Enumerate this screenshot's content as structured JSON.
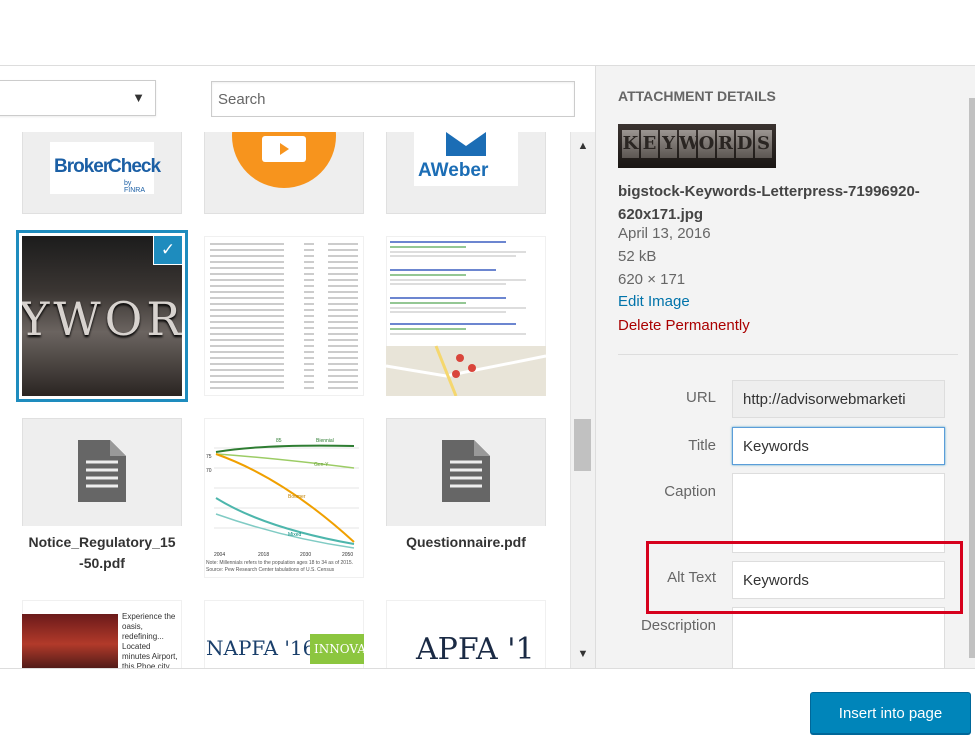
{
  "toolbar": {
    "filter_caret": "▼",
    "search_placeholder": "Search"
  },
  "grid": {
    "row1": [
      {
        "name": "BrokerCheck",
        "brand_a": "Broker",
        "brand_b": "Check",
        "brand_sub": "by FINRA"
      },
      {
        "name": "orange-icon"
      },
      {
        "name": "AWeber",
        "brand": "AWeber"
      }
    ],
    "row2": [
      {
        "name": "Keywords",
        "letters": "YWOR",
        "selected": true
      },
      {
        "name": "table-image"
      },
      {
        "name": "search-results-image"
      }
    ],
    "row3": [
      {
        "file": "Notice_Regulatory_15-50.pdf"
      },
      {
        "name": "chart-image",
        "labels": [
          "85",
          "Biennial",
          "Gen-Y",
          "Boomer",
          "Mixed",
          "75",
          "70"
        ],
        "axis": [
          "2004",
          "2018",
          "2030",
          "2050"
        ],
        "caption": "Note: Millennials refers to the population ages 18 to 34 as of 2015. Source: Pew Research Center tabulations of U.S. Census"
      },
      {
        "file": "Questionnaire.pdf"
      }
    ],
    "row4": [
      {
        "name": "hotel-ad",
        "text": "Experience the oasis, redefining... Located minutes Airport, this Phoe city."
      },
      {
        "name": "NAPFA",
        "text_a": "NAPFA '16",
        "text_b": "INNOVATI"
      },
      {
        "name": "APFA",
        "text": "APFA '1"
      }
    ]
  },
  "scroll": {
    "up": "▲",
    "down": "▼"
  },
  "details": {
    "heading": "Attachment Details",
    "thumb_letters": [
      "K",
      "E",
      "Y",
      "W",
      "O",
      "R",
      "D",
      "S"
    ],
    "filename": "bigstock-Keywords-Letterpress-71996920-620x171.jpg",
    "date": "April 13, 2016",
    "size": "52 kB",
    "dimensions": "620 × 171",
    "edit": "Edit Image",
    "delete": "Delete Permanently",
    "fields": {
      "url_label": "URL",
      "url_value": "http://advisorwebmarketi",
      "title_label": "Title",
      "title_value": "Keywords",
      "caption_label": "Caption",
      "alt_label": "Alt Text",
      "alt_value": "Keywords",
      "description_label": "Description"
    }
  },
  "footer": {
    "insert": "Insert into page"
  },
  "colors": {
    "accent": "#0085ba",
    "selected": "#1e8cbe",
    "delete": "#aa0000",
    "highlight": "#d6001c"
  }
}
